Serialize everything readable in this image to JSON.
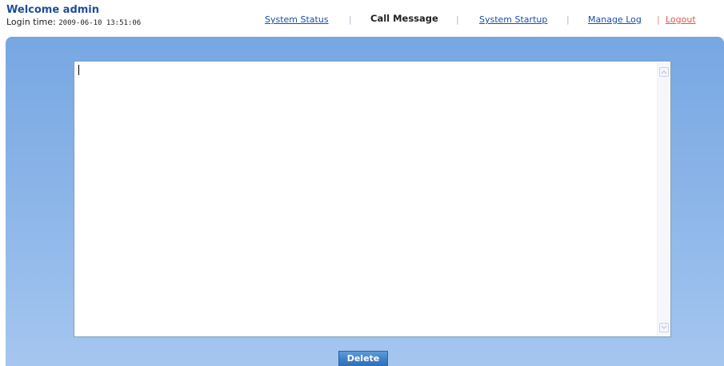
{
  "header": {
    "welcome": "Welcome admin",
    "login_label": "Login time:",
    "login_time": "2009-06-10 13:51:06"
  },
  "nav": {
    "items": [
      {
        "label": "System Status",
        "active": false
      },
      {
        "label": "Call Message",
        "active": true
      },
      {
        "label": "System Startup",
        "active": false
      },
      {
        "label": "Manage Log",
        "active": false
      }
    ],
    "logout": "Logout",
    "separator": "|"
  },
  "message_area": {
    "value": ""
  },
  "actions": {
    "delete_label": "Delete"
  },
  "colors": {
    "brand_text": "#1f4e99",
    "link": "#1a4fa8",
    "logout": "#e0584a",
    "panel_top": "#77a7e2",
    "panel_bottom": "#a5c6ef",
    "button": "#3f7fc6"
  },
  "icons": {
    "scroll_up": "chevron-up-icon",
    "scroll_down": "chevron-down-icon"
  }
}
